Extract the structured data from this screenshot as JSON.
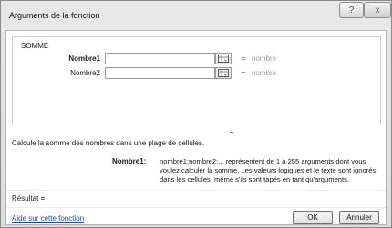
{
  "window": {
    "title": "Arguments de la fonction",
    "help_glyph": "?",
    "close_glyph": "x"
  },
  "group": {
    "label": "SOMME",
    "args": [
      {
        "label": "Nombre1",
        "value": "",
        "equals": "=",
        "hint": "nombre",
        "bold": true
      },
      {
        "label": "Nombre2",
        "value": "",
        "equals": "=",
        "hint": "nombre",
        "bold": false
      }
    ]
  },
  "result_equals": "=",
  "description": "Calcule la somme des nombres dans une plage de cellules.",
  "arg_help": {
    "label": "Nombre1:",
    "lines": [
      "nombre1;nombre2;... représentent de 1 à 255 arguments dont vous",
      "voulez calculer la somme. Les valeurs logiques et le texte sont ignorés",
      "dans les cellules, même s'ils sont tapés en tant qu'arguments."
    ]
  },
  "result_label": "Résultat =",
  "help_link": "Aide sur cette fonction",
  "buttons": {
    "ok": "OK",
    "cancel": "Annuler"
  },
  "icons": {
    "help": "help-icon",
    "close": "close-icon",
    "range_select": "collapse-dialog-icon"
  }
}
